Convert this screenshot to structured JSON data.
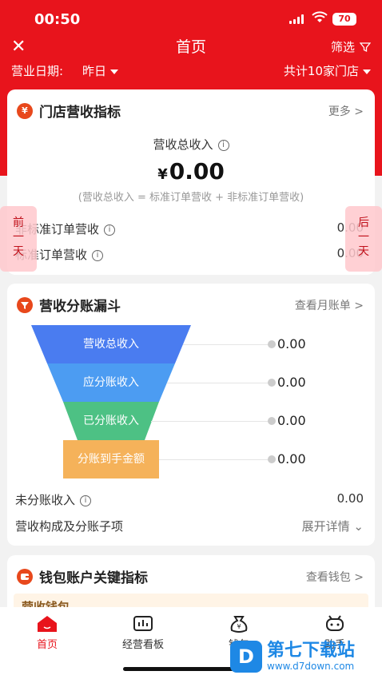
{
  "status": {
    "time": "00:50",
    "battery": "70"
  },
  "nav": {
    "close": "✕",
    "title": "首页",
    "filter": "筛选"
  },
  "subbar": {
    "date_label": "营业日期:",
    "date_value": "昨日",
    "stores": "共计10家门店"
  },
  "store_revenue": {
    "icon_text": "¥",
    "title": "门店营收指标",
    "more": "更多 >",
    "total_label": "营收总收入",
    "currency": "¥",
    "total_value": "0.00",
    "formula": "(营收总收入 = 标准订单营收 + 非标准订单营收)",
    "rows": [
      {
        "label": "非标准订单营收",
        "value": "0.00"
      },
      {
        "label": "标准订单营收",
        "value": "0.00"
      }
    ]
  },
  "side_tabs": {
    "prev": "前一天",
    "next": "后一天"
  },
  "funnel": {
    "title": "营收分账漏斗",
    "more": "查看月账单 >",
    "stages": [
      {
        "label": "营收总收入",
        "value": "0.00",
        "color": "#4a7cf0"
      },
      {
        "label": "应分账收入",
        "value": "0.00",
        "color": "#4c9cf2"
      },
      {
        "label": "已分账收入",
        "value": "0.00",
        "color": "#4dc184"
      },
      {
        "label": "分账到手金额",
        "value": "0.00",
        "color": "#f5b25a"
      }
    ],
    "unsplit_label": "未分账收入",
    "unsplit_value": "0.00",
    "composition_label": "营收构成及分账子项",
    "expand": "展开详情"
  },
  "wallet": {
    "title": "钱包账户关键指标",
    "more": "查看钱包 >",
    "strip": "营收钱包"
  },
  "tabbar": {
    "items": [
      {
        "label": "首页"
      },
      {
        "label": "经营看板"
      },
      {
        "label": "钱包"
      },
      {
        "label": "助手"
      }
    ]
  },
  "watermark": {
    "logo": "D",
    "name": "第七下载站",
    "url": "www.d7down.com"
  },
  "colors": {
    "brand_red": "#e8141c",
    "accent_orange": "#e8481c"
  }
}
